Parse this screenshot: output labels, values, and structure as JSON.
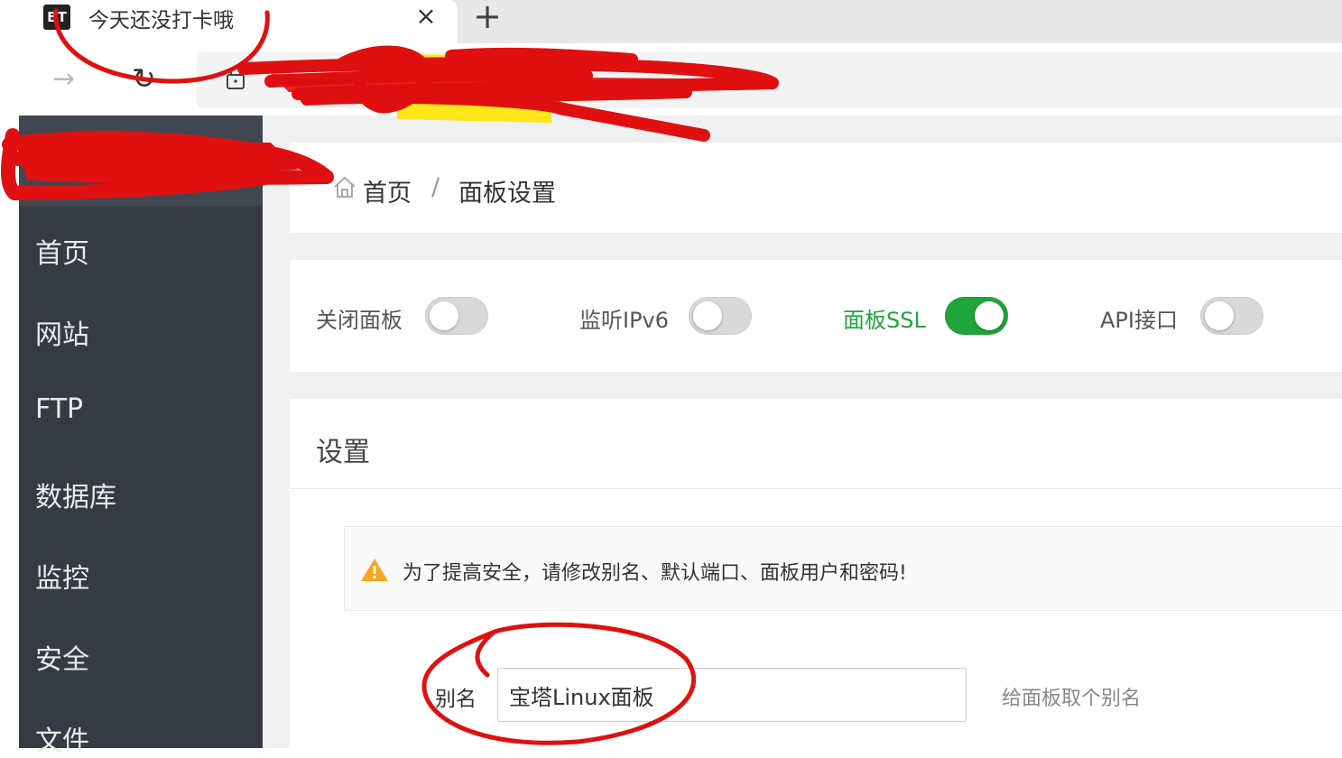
{
  "browser": {
    "favicon_text": "BT",
    "tab_title": "今天还没打卡哦",
    "close_glyph": "×",
    "new_tab_glyph": "+",
    "forward_glyph": "→",
    "reload_glyph": "↻"
  },
  "sidebar": {
    "items": [
      {
        "label": "首页"
      },
      {
        "label": "网站"
      },
      {
        "label": "FTP"
      },
      {
        "label": "数据库"
      },
      {
        "label": "监控"
      },
      {
        "label": "安全"
      },
      {
        "label": "文件"
      }
    ]
  },
  "breadcrumb": {
    "home": "首页",
    "separator": "/",
    "current": "面板设置"
  },
  "switches": [
    {
      "label": "关闭面板",
      "checked": false
    },
    {
      "label": "监听IPv6",
      "checked": false
    },
    {
      "label": "面板SSL",
      "checked": true
    },
    {
      "label": "API接口",
      "checked": false
    }
  ],
  "settings": {
    "title": "设置",
    "warning": "为了提高安全，请修改别名、默认端口、面板用户和密码!",
    "alias_label": "别名",
    "alias_value": "宝塔Linux面板",
    "alias_help": "给面板取个别名"
  },
  "colors": {
    "accent_green": "#20a53a",
    "sidebar_bg": "#363b43",
    "warning_orange": "#f5a623",
    "annotation_red": "#e01010",
    "highlight_yellow": "#ffe400"
  }
}
